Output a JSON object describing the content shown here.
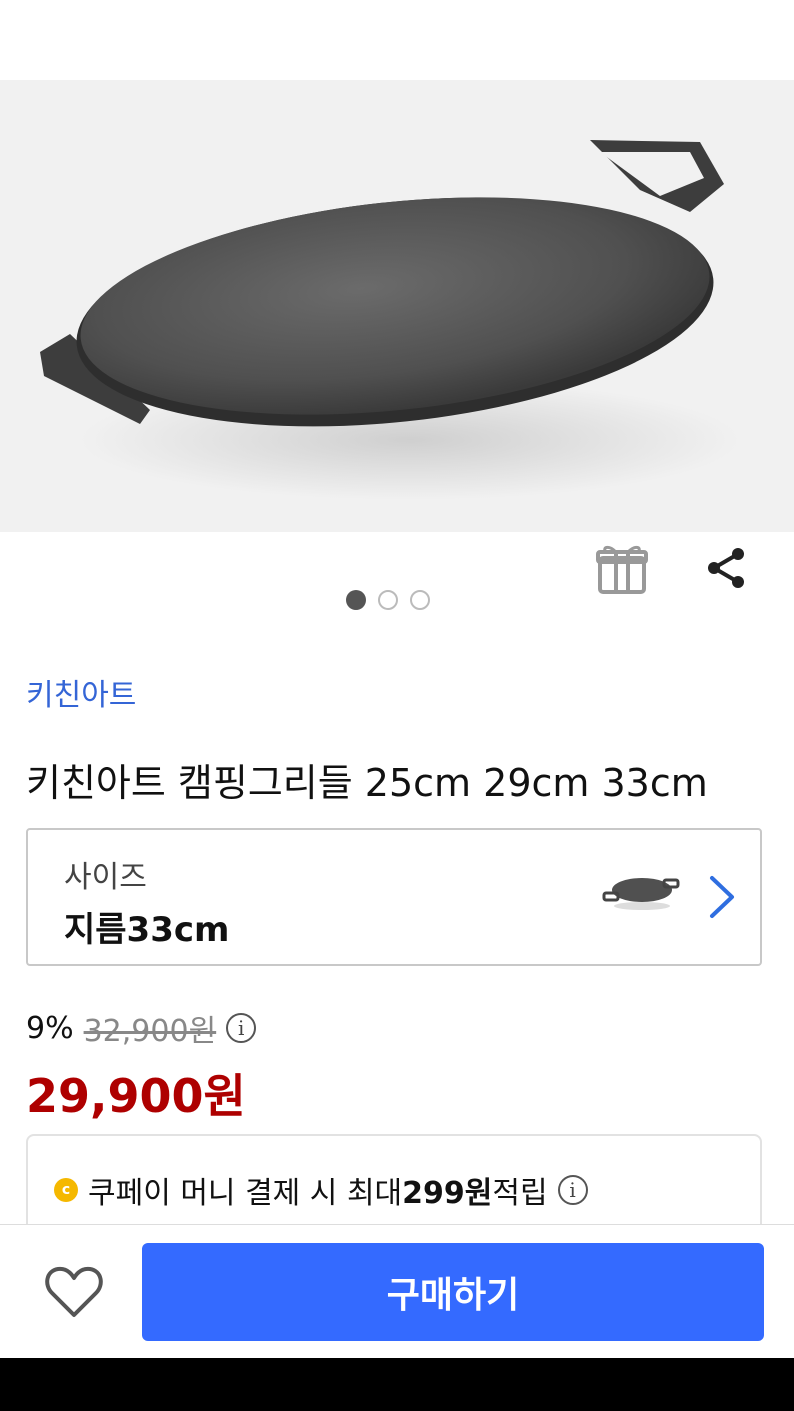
{
  "product": {
    "brand": "키친아트",
    "title": "키친아트 캠핑그리들 25cm 29cm 33cm",
    "image_carousel": {
      "total": 3,
      "active_index": 1
    }
  },
  "option": {
    "label": "사이즈",
    "value": "지름33cm"
  },
  "price": {
    "discount": "9%",
    "original": "32,900원",
    "sale": "29,900원"
  },
  "reward": {
    "coin_symbol": "c",
    "text_before": "쿠페이 머니 결제 시 최대 ",
    "amount": "299원",
    "text_after": " 적립"
  },
  "bottom_bar": {
    "buy_label": "구매하기"
  },
  "icons": {
    "gift": "gift-icon",
    "share": "share-icon",
    "heart": "heart-icon",
    "info": "info-icon",
    "chevron": "chevron-right-icon"
  },
  "colors": {
    "brand_link": "#3465d6",
    "sale_price": "#ae0000",
    "buy_button": "#346aff",
    "coin": "#f5b800"
  }
}
